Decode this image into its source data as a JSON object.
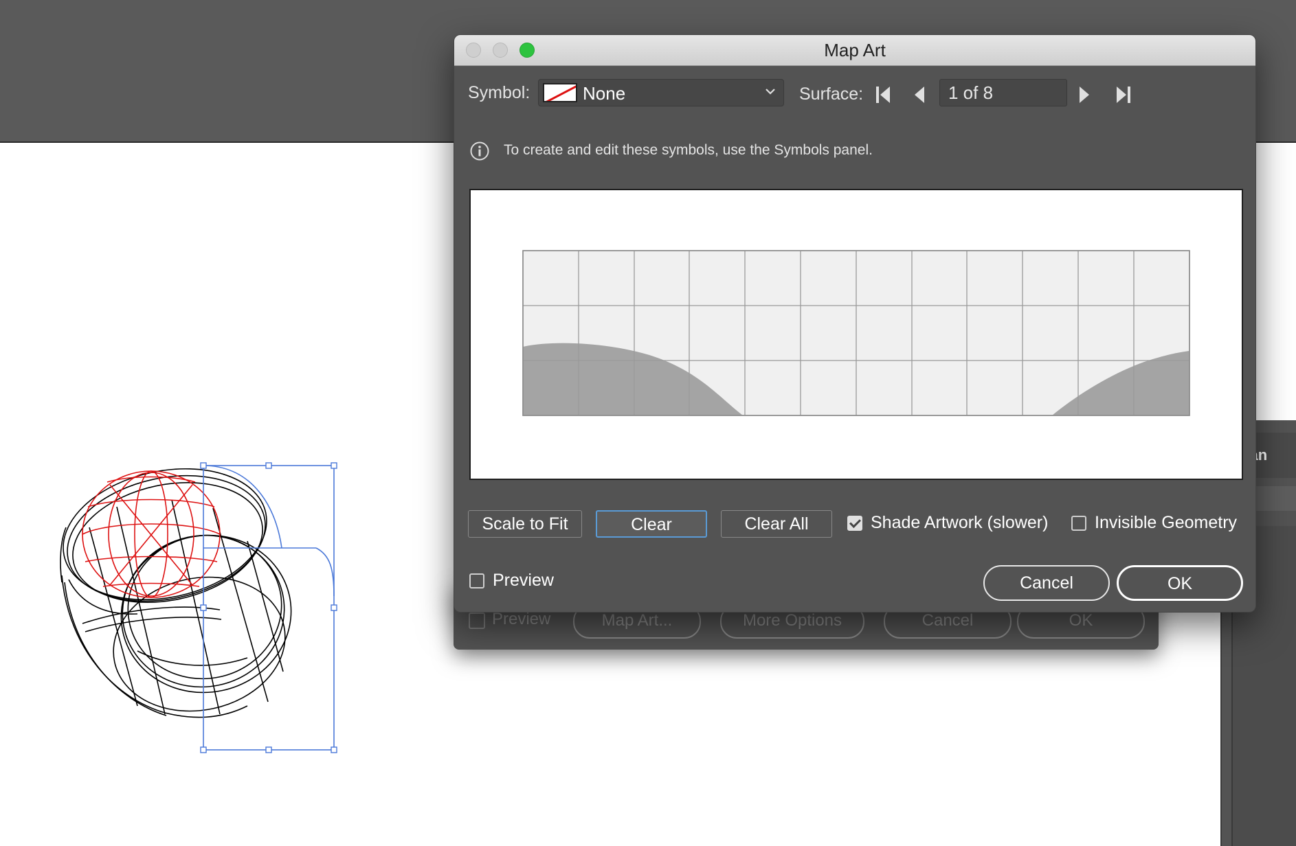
{
  "dialog": {
    "title": "Map Art",
    "symbol_label": "Symbol:",
    "symbol_value": "None",
    "surface_label": "Surface:",
    "surface_value": "1 of 8",
    "info_text": "To create and edit these symbols, use the Symbols panel.",
    "buttons": {
      "scale_to_fit": "Scale to Fit",
      "clear": "Clear",
      "clear_all": "Clear All",
      "cancel": "Cancel",
      "ok": "OK"
    },
    "checkboxes": {
      "shade_artwork": {
        "label": "Shade Artwork (slower)",
        "checked": true
      },
      "invisible_geometry": {
        "label": "Invisible Geometry",
        "checked": false
      },
      "preview": {
        "label": "Preview",
        "checked": false
      }
    }
  },
  "background_dialog": {
    "preview_label": "Preview",
    "map_art_button": "Map Art...",
    "more_options_button": "More Options",
    "cancel_button": "Cancel",
    "ok_button": "OK"
  },
  "right_panel": {
    "tab_label": "pearan"
  },
  "colors": {
    "dialog_bg": "#535353",
    "accent": "#5a9bd6",
    "selection_blue": "#4a78d8",
    "symbol_red": "#dd1111",
    "zoom_green": "#2dc33f"
  }
}
